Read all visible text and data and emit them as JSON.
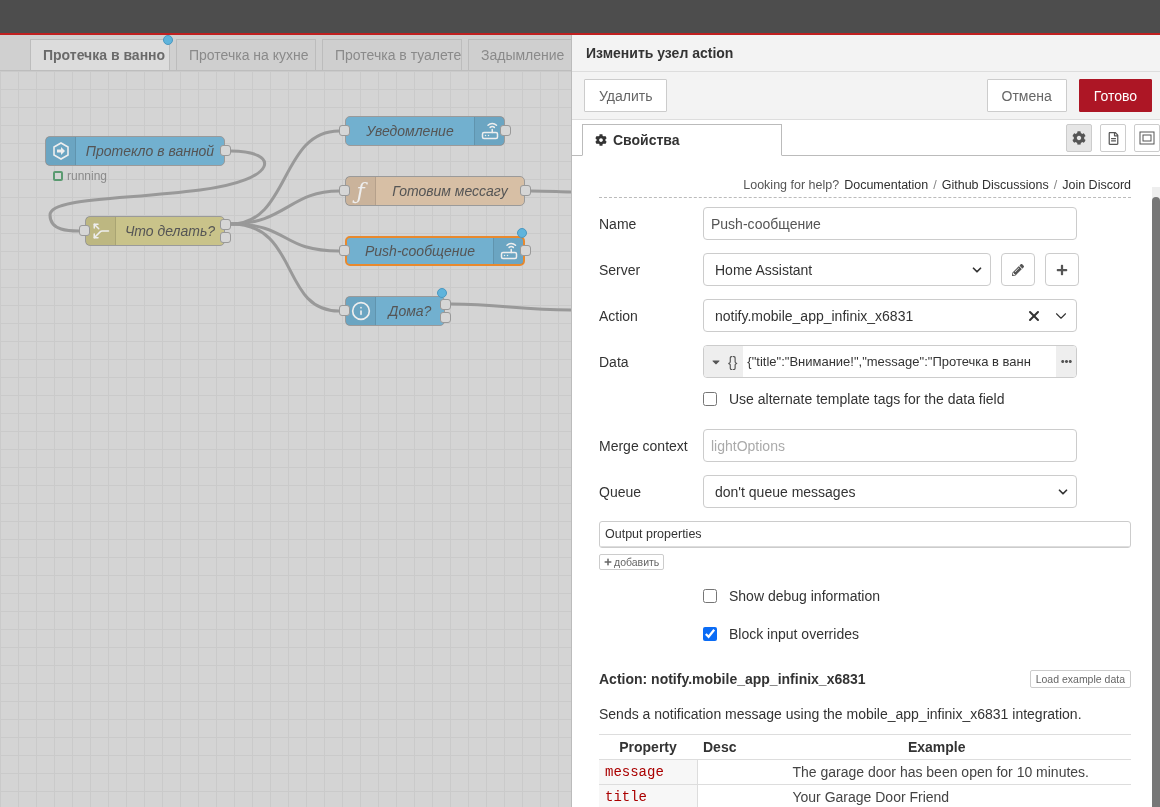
{
  "flow_tabs": [
    {
      "label": "Протечка в ванно",
      "selected": true,
      "changed": true
    },
    {
      "label": "Протечка на кухне",
      "selected": false,
      "changed": false
    },
    {
      "label": "Протечка в туалете",
      "selected": false,
      "changed": false
    },
    {
      "label": "Задымление",
      "selected": false,
      "changed": false
    }
  ],
  "nodes": [
    {
      "kind": "trigger",
      "label": "Протекло в ванной",
      "color": "#72b0cf",
      "selected": false,
      "changed": false,
      "status": {
        "text": "running",
        "color": "#5a9a70"
      }
    },
    {
      "kind": "switch",
      "label": "Что делать?",
      "color": "#c9c38a",
      "selected": false,
      "changed": false
    },
    {
      "kind": "router",
      "label": "Уведомление",
      "color": "#72b0cf",
      "selected": false,
      "changed": false
    },
    {
      "kind": "function",
      "label": "Готовим мессагу",
      "icon_text": "ƒ",
      "color": "#d7bfa5",
      "selected": false,
      "changed": false
    },
    {
      "kind": "router",
      "label": "Push-сообщение",
      "color": "#72b0cf",
      "selected": true,
      "changed": true
    },
    {
      "kind": "info",
      "label": "Дома?",
      "color": "#72b0cf",
      "selected": false,
      "changed": true
    }
  ],
  "editor": {
    "title": "Изменить узел action",
    "buttons": {
      "delete": "Удалить",
      "cancel": "Отмена",
      "done": "Готово"
    },
    "tabs": [
      {
        "label": "Свойства",
        "selected": true
      }
    ],
    "help": [
      {
        "kind": "text",
        "text": "Looking for help?"
      },
      {
        "kind": "link",
        "text": "Documentation"
      },
      {
        "kind": "separator",
        "text": "/"
      },
      {
        "kind": "link",
        "text": "Github Discussions"
      },
      {
        "kind": "separator",
        "text": "/"
      },
      {
        "kind": "link",
        "text": "Join Discord"
      }
    ],
    "fields": [
      {
        "kind": "text",
        "label": "Name",
        "value": "Push-сообщение"
      },
      {
        "kind": "server",
        "label": "Server",
        "value": "Home Assistant"
      },
      {
        "kind": "combo",
        "label": "Action",
        "value": "notify.mobile_app_infinix_x6831"
      },
      {
        "kind": "typed",
        "label": "Data",
        "type_text": "{}",
        "value": "{\"title\":\"Внимание!\",\"message\":\"Протечка в ванн"
      },
      {
        "kind": "checkbox",
        "label": "Use alternate template tags for the data field",
        "checked": false
      },
      {
        "kind": "text",
        "label": "Merge context",
        "placeholder": "lightOptions"
      },
      {
        "kind": "select",
        "label": "Queue",
        "value": "don't queue messages"
      },
      {
        "kind": "list",
        "label": "Output properties",
        "add_label": "добавить"
      },
      {
        "kind": "checkbox",
        "label": "Show debug information",
        "checked": false
      },
      {
        "kind": "checkbox",
        "label": "Block input overrides",
        "checked": true
      }
    ],
    "doc": {
      "heading": "Action: notify.mobile_app_infinix_x6831",
      "load_button": "Load example data",
      "description": "Sends a notification message using the mobile_app_infinix_x6831 integration.",
      "columns": [
        "Property",
        "Desc",
        "Example"
      ],
      "rows": [
        {
          "property": "message",
          "desc": "",
          "example": "The garage door has been open for 10 minutes."
        },
        {
          "property": "title",
          "desc": "",
          "example": "Your Garage Door Friend"
        }
      ]
    }
  }
}
